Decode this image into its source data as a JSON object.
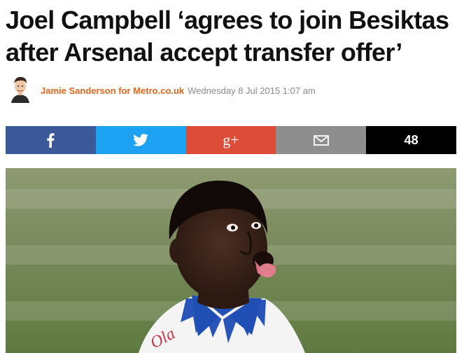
{
  "article": {
    "headline": "Joel Campbell ‘agrees to join Besiktas after Arsenal accept transfer offer’",
    "author": "Jamie Sanderson for Metro.co.uk",
    "date": "Wednesday 8 Jul 2015 1:07 am"
  },
  "share": {
    "facebook_icon": "facebook-icon",
    "twitter_icon": "twitter-icon",
    "googleplus_label": "g+",
    "email_icon": "envelope-icon",
    "count": "48"
  },
  "colors": {
    "author": "#e2661b",
    "facebook": "#3b5998",
    "twitter": "#1da1f2",
    "googleplus": "#dd4b39",
    "email": "#8e8e8e",
    "count_bg": "#000000"
  },
  "photo": {
    "shirt_text": "Ola"
  }
}
